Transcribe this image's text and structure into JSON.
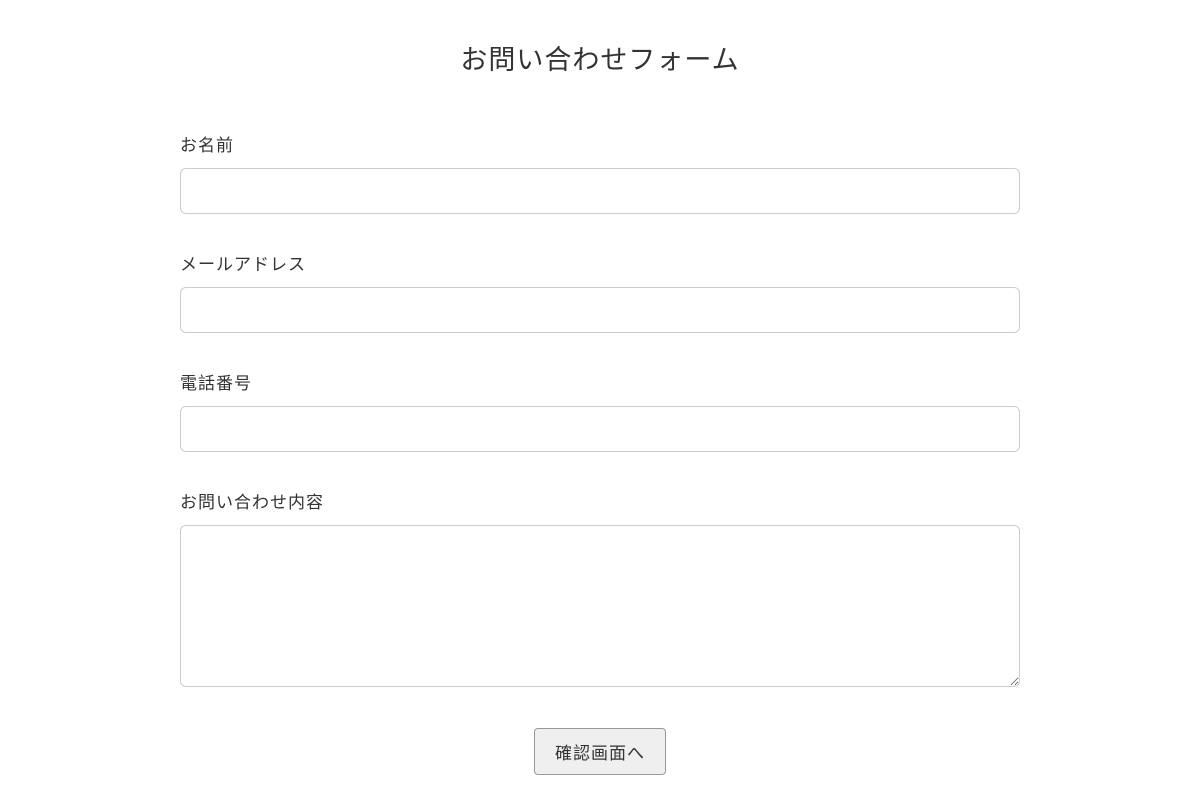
{
  "title": "お問い合わせフォーム",
  "fields": {
    "name": {
      "label": "お名前",
      "value": ""
    },
    "email": {
      "label": "メールアドレス",
      "value": ""
    },
    "phone": {
      "label": "電話番号",
      "value": ""
    },
    "message": {
      "label": "お問い合わせ内容",
      "value": ""
    }
  },
  "submit_label": "確認画面へ"
}
